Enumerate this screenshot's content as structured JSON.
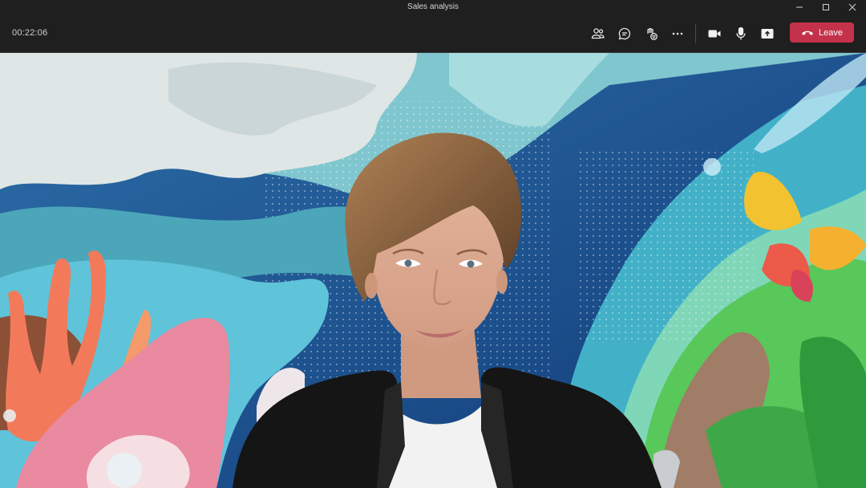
{
  "window": {
    "title": "Sales analysis",
    "minimize_icon": "minimize-icon",
    "maximize_icon": "maximize-icon",
    "close_icon": "close-icon"
  },
  "toolbar": {
    "timer": "00:22:06",
    "people_icon": "people-icon",
    "chat_icon": "chat-icon",
    "reactions_icon": "reactions-icon",
    "more_icon": "more-icon",
    "camera_icon": "camera-icon",
    "mic_icon": "microphone-icon",
    "share_icon": "share-icon",
    "leave_label": "Leave",
    "leave_color": "#c4314b"
  },
  "stage": {
    "participant": "video-participant",
    "background": "ocean-illustration-background"
  }
}
